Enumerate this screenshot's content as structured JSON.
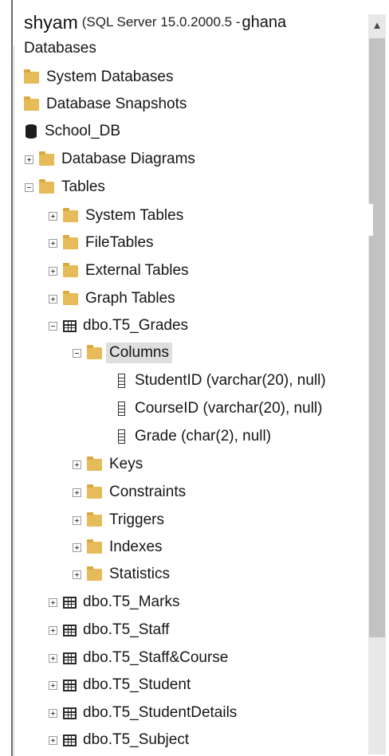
{
  "header": {
    "instance_name": "shyam",
    "server_info": "(SQL Server 15.0.2000.5 -",
    "login": "ghana"
  },
  "tree": {
    "databases": "Databases",
    "system_databases": "System Databases",
    "database_snapshots": "Database Snapshots",
    "school_db": "School_DB",
    "database_diagrams": "Database Diagrams",
    "tables": "Tables",
    "system_tables": "System Tables",
    "file_tables": "FileTables",
    "external_tables": "External Tables",
    "graph_tables": "Graph Tables",
    "t5_grades": "dbo.T5_Grades",
    "columns": "Columns",
    "columns_list": [
      "StudentID (varchar(20), null)",
      "CourseID (varchar(20), null)",
      "Grade (char(2), null)"
    ],
    "keys": "Keys",
    "constraints": "Constraints",
    "triggers": "Triggers",
    "indexes": "Indexes",
    "statistics": "Statistics",
    "tables_list": [
      "dbo.T5_Marks",
      "dbo.T5_Staff",
      "dbo.T5_Staff&Course",
      "dbo.T5_Student",
      "dbo.T5_StudentDetails",
      "dbo.T5_Subject"
    ]
  },
  "icons": {
    "folder": "folder-icon",
    "database": "database-icon",
    "table": "table-icon",
    "column": "column-icon",
    "expand": "expand-plus-icon",
    "collapse": "collapse-minus-icon",
    "scroll_up": "chevron-up-icon"
  },
  "colors": {
    "folder": "#e6bc5a",
    "selection": "#dedede",
    "scrollbar_track": "#e8e8e8",
    "scrollbar_thumb": "#c2c2c2"
  }
}
